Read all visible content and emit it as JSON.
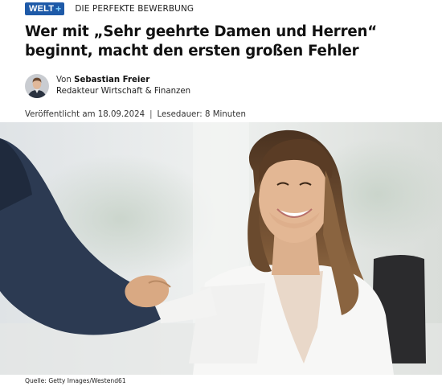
{
  "brand": {
    "logo_text": "WELT",
    "logo_plus": "+",
    "color": "#1e5aa8"
  },
  "kicker": "DIE PERFEKTE BEWERBUNG",
  "headline": "Wer mit „Sehr geehrte Damen und Herren“ beginnt, macht den ersten großen Fehler",
  "author": {
    "prefix": "Von",
    "name": "Sebastian Freier",
    "role": "Redakteur Wirtschaft & Finanzen"
  },
  "meta": {
    "published": "Veröffentlicht am 18.09.2024",
    "separator": "|",
    "reading_time": "Lesedauer: 8 Minuten"
  },
  "image": {
    "caption": "Quelle: Getty Images/Westend61"
  }
}
